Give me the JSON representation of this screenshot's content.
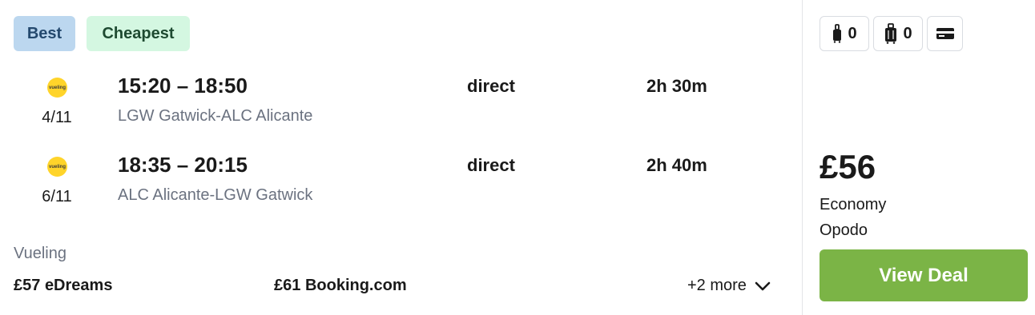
{
  "badges": {
    "best": "Best",
    "cheapest": "Cheapest"
  },
  "legs": [
    {
      "logo": "vueling",
      "date": "4/11",
      "times": "15:20 – 18:50",
      "route": "LGW Gatwick-ALC Alicante",
      "stops": "direct",
      "duration": "2h 30m"
    },
    {
      "logo": "vueling",
      "date": "6/11",
      "times": "18:35 – 20:15",
      "route": "ALC Alicante-LGW Gatwick",
      "stops": "direct",
      "duration": "2h 40m"
    }
  ],
  "airline": "Vueling",
  "alternatives": [
    {
      "price": "£57",
      "site": "eDreams"
    },
    {
      "price": "£61",
      "site": "Booking.com"
    }
  ],
  "more_label": "+2 more",
  "fees": {
    "carry_on_count": "0",
    "checked_bag_count": "0"
  },
  "icons": {
    "carry_on": "carry-on-bag-icon",
    "checked": "checked-bag-icon",
    "card": "credit-card-icon",
    "chevron": "chevron-down-icon"
  },
  "deal": {
    "price": "£56",
    "cabin": "Economy",
    "provider": "Opodo",
    "button": "View Deal"
  },
  "colors": {
    "best_bg": "#bcd7ef",
    "cheapest_bg": "#d4f7e1",
    "deal_button": "#7bb446",
    "logo": "#ffd42a"
  }
}
